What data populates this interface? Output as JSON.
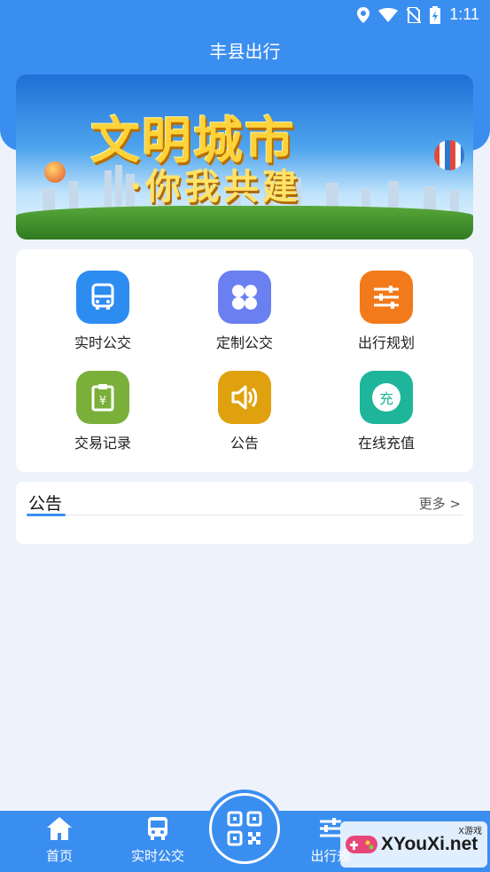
{
  "status_bar": {
    "time": "1:11",
    "icons": [
      "location-icon",
      "wifi-icon",
      "no-sim-icon",
      "battery-charging-icon"
    ]
  },
  "app": {
    "title": "丰县出行"
  },
  "banner": {
    "line1": "文明城市",
    "line2": "·你我共建"
  },
  "menu": {
    "items": [
      {
        "label": "实时公交",
        "icon": "bus-icon",
        "color": "#2d8cf0"
      },
      {
        "label": "定制公交",
        "icon": "four-petal-icon",
        "color": "#6a7ff0"
      },
      {
        "label": "出行规划",
        "icon": "sliders-icon",
        "color": "#f27a1a"
      },
      {
        "label": "交易记录",
        "icon": "receipt-clipboard-icon",
        "color": "#7ab03a"
      },
      {
        "label": "公告",
        "icon": "speaker-icon",
        "color": "#e0a10e"
      },
      {
        "label": "在线充值",
        "icon": "recharge-icon",
        "color": "#1fb59a",
        "badge": "充"
      }
    ]
  },
  "notice": {
    "title": "公告",
    "more": "更多 >"
  },
  "bottom_nav": {
    "items": [
      {
        "label": "首页",
        "icon": "home-icon"
      },
      {
        "label": "实时公交",
        "icon": "bus-icon"
      },
      {
        "label": "",
        "icon": "qr-code-icon"
      },
      {
        "label": "出行规",
        "icon": "sliders-icon"
      }
    ]
  },
  "watermark": {
    "text": "XYouXi.net",
    "small": "X游戏"
  },
  "colors": {
    "primary": "#3a8ef0",
    "background": "#eef3fb"
  }
}
